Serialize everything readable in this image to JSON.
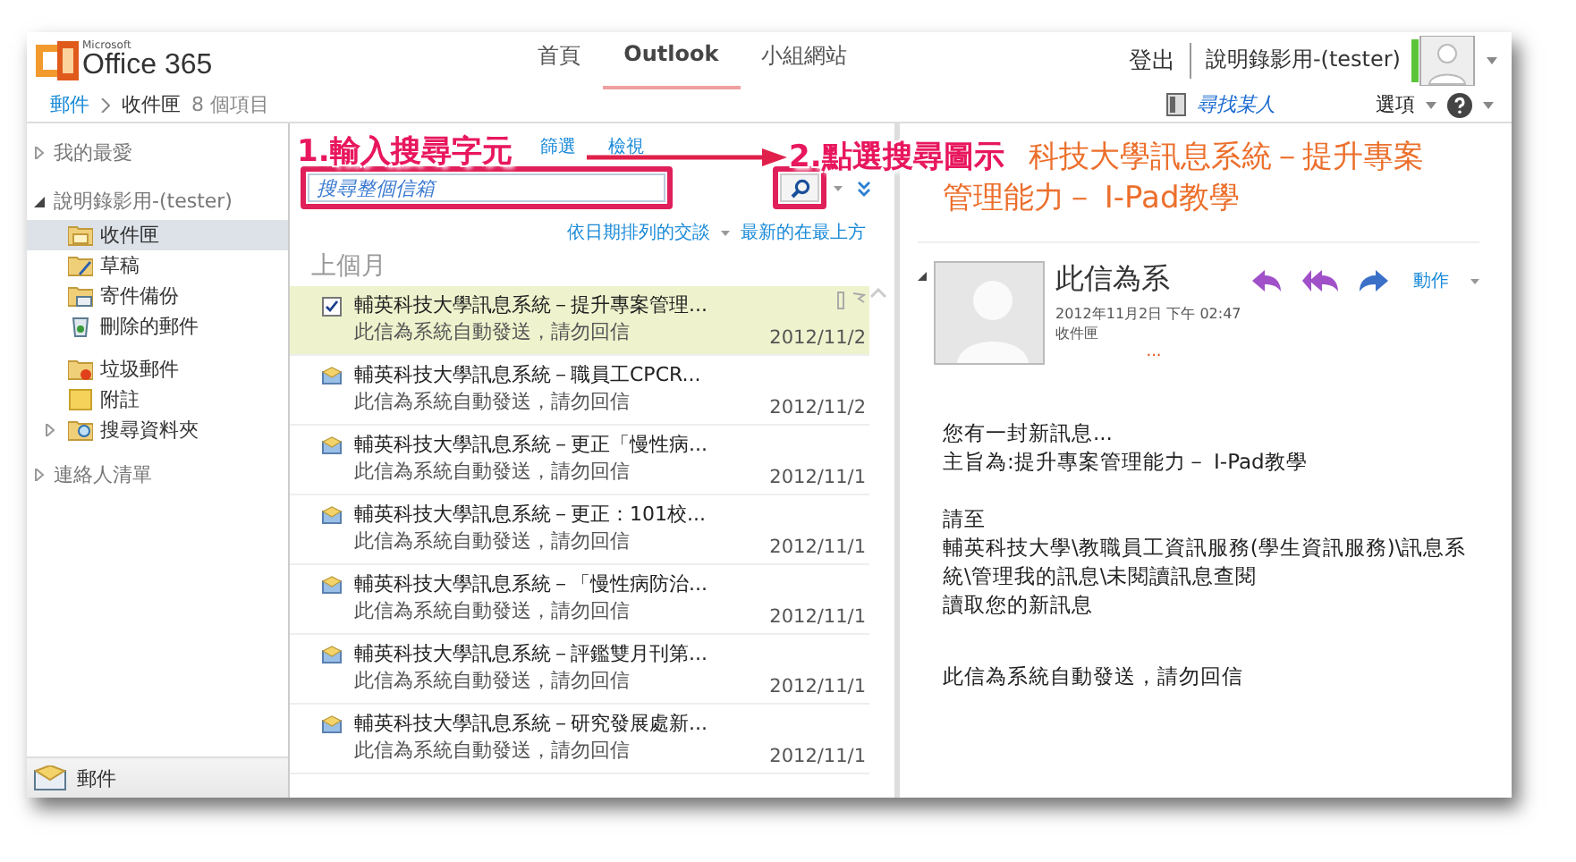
{
  "header": {
    "logo_small": "Microsoft",
    "logo": "Office 365",
    "nav": [
      {
        "label": "首頁",
        "selected": false
      },
      {
        "label": "Outlook",
        "selected": true
      },
      {
        "label": "小組網站",
        "selected": false
      }
    ],
    "sign_out": "登出",
    "user": "說明錄影用-(tester)"
  },
  "breadcrumb": {
    "root": "郵件",
    "folder": "收件匣",
    "count": "8 個項目",
    "find_people": "尋找某人",
    "options": "選項"
  },
  "sidebar": {
    "sections": [
      {
        "label": "我的最愛",
        "expanded": false
      },
      {
        "label": "說明錄影用-(tester)",
        "expanded": true,
        "children": [
          {
            "label": "收件匣",
            "kind": "inbox",
            "selected": true
          },
          {
            "label": "草稿",
            "kind": "drafts",
            "selected": false
          },
          {
            "label": "寄件備份",
            "kind": "sent",
            "selected": false
          },
          {
            "label": "刪除的郵件",
            "kind": "deleted",
            "selected": false
          },
          {
            "label": "垃圾郵件",
            "kind": "junk",
            "selected": false
          },
          {
            "label": "附註",
            "kind": "notes",
            "selected": false
          },
          {
            "label": "搜尋資料夾",
            "kind": "search",
            "selected": false,
            "expandable": true
          }
        ]
      },
      {
        "label": "連絡人清單",
        "expanded": false
      }
    ],
    "bottom_label": "郵件"
  },
  "list": {
    "links": [
      "篩選",
      "檢視"
    ],
    "search": {
      "placeholder": "搜尋整個信箱"
    },
    "sort": "依日期排列的交談",
    "order": "最新的在最上方",
    "group": "上個月",
    "messages": [
      {
        "subject": "輔英科技大學訊息系統－提升專案管理...",
        "preview": "此信為系統自動發送，請勿回信",
        "date": "2012/11/2",
        "selected": true
      },
      {
        "subject": "輔英科技大學訊息系統－職員工CPCR...",
        "preview": "此信為系統自動發送，請勿回信",
        "date": "2012/11/2",
        "selected": false
      },
      {
        "subject": "輔英科技大學訊息系統－更正「慢性病...",
        "preview": "此信為系統自動發送，請勿回信",
        "date": "2012/11/1",
        "selected": false
      },
      {
        "subject": "輔英科技大學訊息系統－更正：101校...",
        "preview": "此信為系統自動發送，請勿回信",
        "date": "2012/11/1",
        "selected": false
      },
      {
        "subject": "輔英科技大學訊息系統－「慢性病防治...",
        "preview": "此信為系統自動發送，請勿回信",
        "date": "2012/11/1",
        "selected": false
      },
      {
        "subject": "輔英科技大學訊息系統－評鑑雙月刊第...",
        "preview": "此信為系統自動發送，請勿回信",
        "date": "2012/11/1",
        "selected": false
      },
      {
        "subject": "輔英科技大學訊息系統－研究發展處新...",
        "preview": "此信為系統自動發送，請勿回信",
        "date": "2012/11/1",
        "selected": false
      }
    ]
  },
  "reading": {
    "title_lines": [
      "科技大學訊息系統－提升專案",
      "管理能力－ I-Pad教學"
    ],
    "sender": "此信為系",
    "date": "2012年11月2日 下午 02:47",
    "folder": "收件匣",
    "more": "...",
    "actions": "動作",
    "body": [
      [
        "您有一封新訊息...",
        "主旨為:提升專案管理能力－ I-Pad教學"
      ],
      [
        "請至",
        "輔英科技大學\\教職員工資訊服務(學生資訊服務)\\訊息系統\\管理我的訊息\\未閱讀訊息查閱",
        "讀取您的新訊息"
      ],
      [
        "此信為系統自動發送，請勿回信"
      ]
    ]
  },
  "annotations": [
    {
      "text": "1.輸入搜尋字元"
    },
    {
      "text": "2.點選搜尋圖示"
    }
  ]
}
